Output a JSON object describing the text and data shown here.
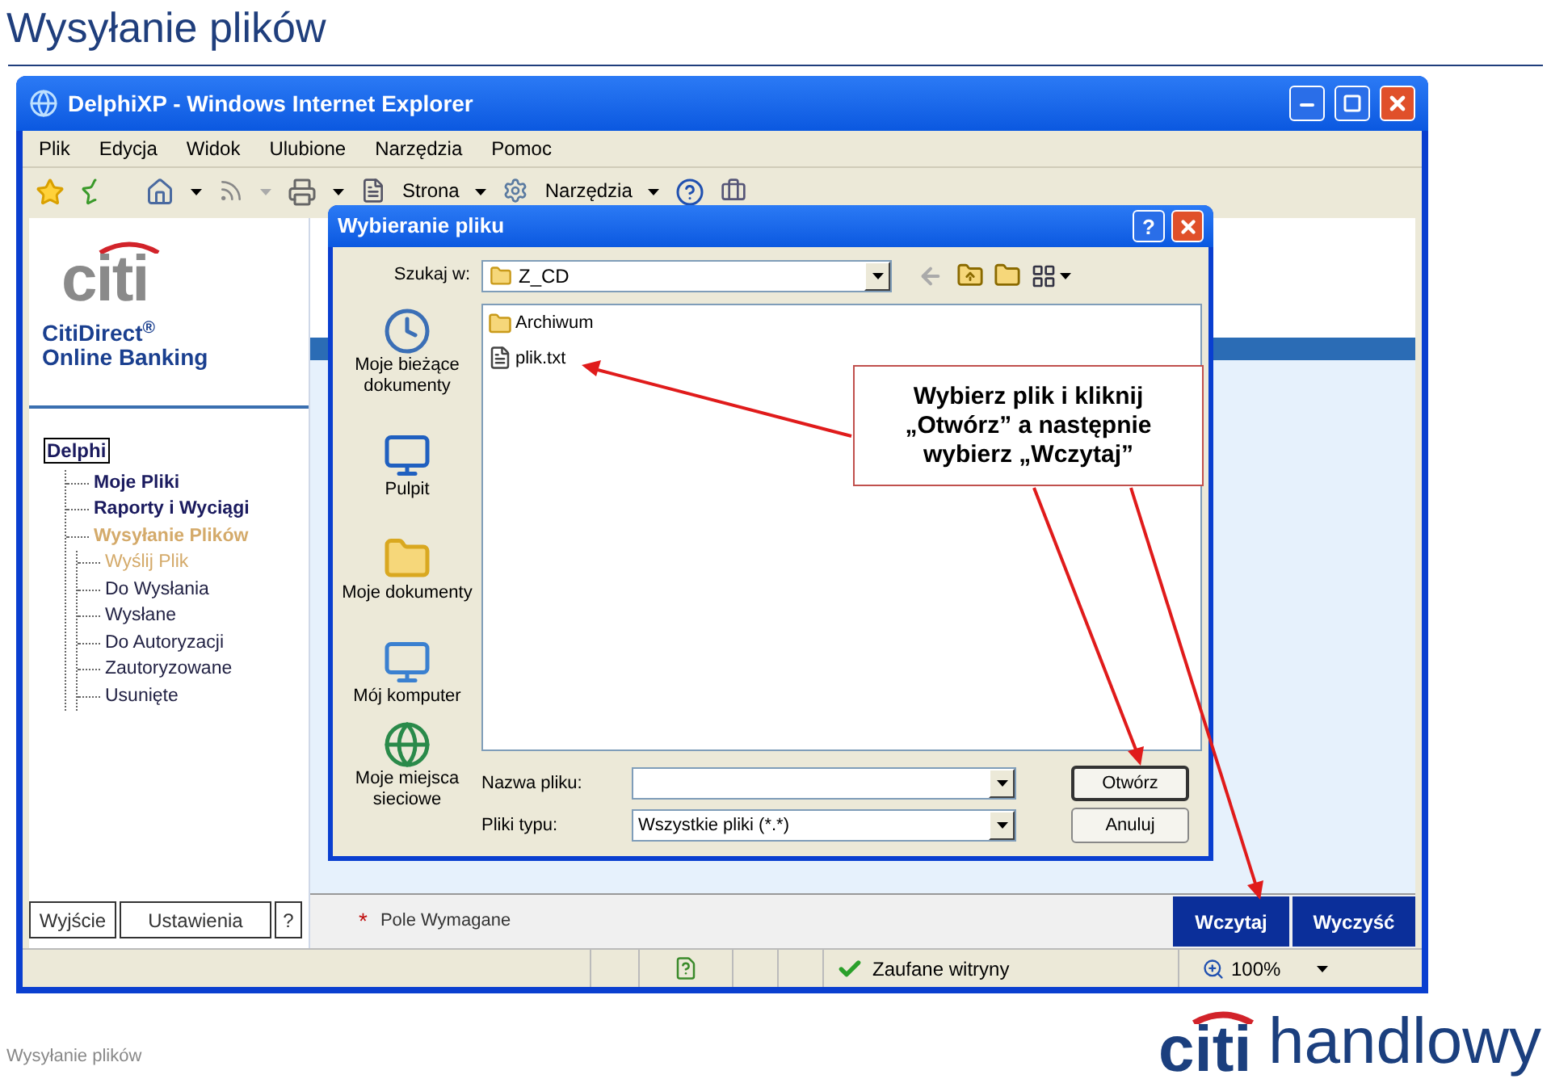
{
  "slide": {
    "title": "Wysyłanie plików",
    "footer": "Wysyłanie plików",
    "logo": {
      "mark": "citi",
      "name": "handlowy"
    }
  },
  "browser": {
    "title": "DelphiXP - Windows Internet Explorer",
    "menu": [
      "Plik",
      "Edycja",
      "Widok",
      "Ulubione",
      "Narzędzia",
      "Pomoc"
    ],
    "toolbar": [
      {
        "label": "Strona"
      },
      {
        "label": "Narzędzia"
      }
    ],
    "sidebar": {
      "logo": "citi",
      "product": "CitiDirect$^{®}$",
      "product_line": "Online Banking",
      "tree": {
        "label": "Delphi",
        "children": [
          {
            "label": "Moje Pliki",
            "selected": false
          },
          {
            "label": "Raporty i Wyciągi",
            "selected": false
          },
          {
            "label": "Wysyłanie Plików",
            "selected": true,
            "children": [
              {
                "label": "Wyślij Plik",
                "selected": true
              },
              {
                "label": "Do Wysłania",
                "selected": false
              },
              {
                "label": "Wysłane",
                "selected": false
              },
              {
                "label": "Do Autoryzacji",
                "selected": false
              },
              {
                "label": "Zautoryzowane",
                "selected": false
              },
              {
                "label": "Usunięte",
                "selected": false
              }
            ]
          }
        ]
      },
      "buttons": [
        "Wyjście",
        "Ustawienia",
        "?"
      ]
    },
    "main": {
      "required_mark": "*",
      "required_note": "Pole Wymagane",
      "buttons": [
        "Wczytaj",
        "Wyczyść"
      ]
    },
    "status_bar": {
      "zone": "Zaufane witryny",
      "zoom": "100%"
    }
  },
  "dialog": {
    "title": "Wybieranie pliku",
    "help_button": "?",
    "look_in_label": "Szukaj w:",
    "look_in_value": "Z_CD",
    "places": [
      {
        "label": "Moje bieżące dokumenty",
        "kind": "recent"
      },
      {
        "label": "Pulpit",
        "kind": "desktop"
      },
      {
        "label": "Moje dokumenty",
        "kind": "documents"
      },
      {
        "label": "Mój komputer",
        "kind": "computer"
      },
      {
        "label": "Moje miejsca sieciowe",
        "kind": "network"
      }
    ],
    "files": [
      {
        "name": "Archiwum",
        "kind": "folder"
      },
      {
        "name": "plik.txt",
        "kind": "file"
      }
    ],
    "file_name_label": "Nazwa pliku:",
    "file_type_label": "Pliki typu:",
    "file_type_value": "Wszystkie pliki (*.*)",
    "buttons": [
      "Otwórz",
      "Anuluj"
    ]
  },
  "callout": {
    "lines": [
      "Wybierz plik i kliknij",
      "„Otwórz” a następnie",
      "wybierz „Wczytaj”"
    ]
  }
}
